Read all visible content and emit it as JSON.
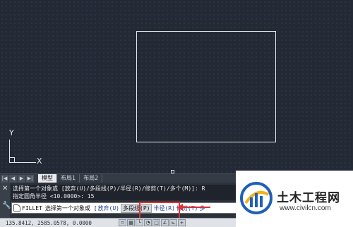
{
  "canvas": {
    "ucs_y_label": "Y",
    "ucs_x_label": "X"
  },
  "tabs": {
    "nav_buttons": [
      "|◀",
      "◀",
      "▶",
      "▶|"
    ],
    "items": [
      "模型",
      "布局1",
      "布局2"
    ],
    "active": "模型"
  },
  "command": {
    "side_close": "✕",
    "side_tool": "🔧",
    "history_line1": "选择第一个对象或 [放弃(U)/多段线(P)/半径(R)/修剪(T)/多个(M)]: R",
    "history_line2": "指定圆角半径 <10.0000>: 15",
    "cmd_name": "FILLET",
    "prompt": "选择第一个对象或 [",
    "options": [
      "放弃(U)",
      "多段线(P)",
      "半径(R)",
      "修剪(T)",
      "多"
    ],
    "highlighted_option": "多段线(P)"
  },
  "statusbar": {
    "coords": "135.8412, 2585.0578, 0.0000"
  },
  "watermark": {
    "title": "土木工程网",
    "url": "www.civilcn.com"
  },
  "colors": {
    "canvas_bg": "#232a36",
    "highlight_red": "#e03030",
    "option_blue": "#1a3f9a"
  }
}
